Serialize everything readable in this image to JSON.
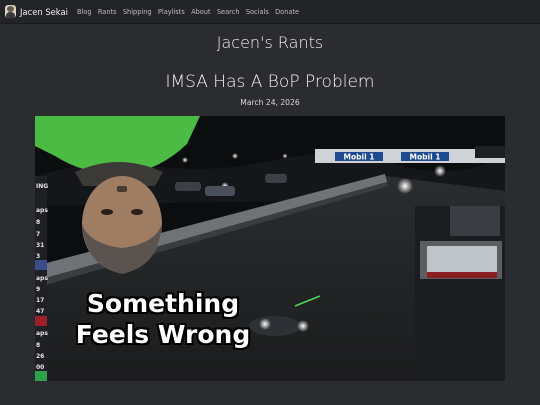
{
  "nav": {
    "brand": "Jacen Sekai",
    "links": [
      "Blog",
      "Rants",
      "Shipping",
      "Playlists",
      "About",
      "Search",
      "Socials",
      "Donate"
    ]
  },
  "page": {
    "site_title": "Jacen's Rants",
    "post_title": "IMSA Has A BoP Problem",
    "post_date": "March 24, 2026"
  },
  "hero": {
    "caption_line1": "Something",
    "caption_line2": "Feels Wrong",
    "sign_left": "Mobil 1",
    "sign_right": "Mobil 1",
    "timing_rows": [
      "ING",
      "aps",
      "8",
      "7",
      "31",
      "3",
      "aps",
      "9",
      "17",
      "47",
      "aps",
      "8",
      "26",
      "00"
    ]
  },
  "colors": {
    "background": "#2b2c2f",
    "navbar": "#232427",
    "caption_text": "#ffffff"
  }
}
